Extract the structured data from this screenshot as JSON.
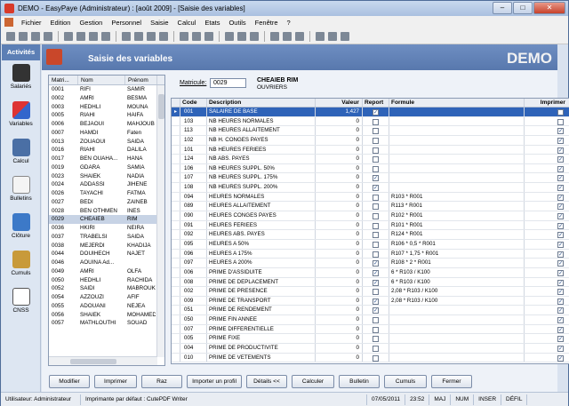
{
  "window": {
    "title": "DEMO - EasyPaye (Administrateur) : [août 2009] - [Saisie des variables]",
    "min": "–",
    "max": "□",
    "close": "✕"
  },
  "menu": [
    "Fichier",
    "Edition",
    "Gestion",
    "Personnel",
    "Saisie",
    "Calcul",
    "Etats",
    "Outils",
    "Fenêtre",
    "?"
  ],
  "sidebar": {
    "title": "Activités",
    "items": [
      "Salariés",
      "Variables",
      "Calcul",
      "Bulletins",
      "Clôture",
      "Cumuls",
      "CNSS"
    ]
  },
  "header": {
    "title": "Saisie des variables",
    "brand": "DEMO"
  },
  "employees": {
    "columns": [
      "Matri...",
      "Nom",
      "Prénom"
    ],
    "rows": [
      [
        "0001",
        "RIFI",
        "SAMIR"
      ],
      [
        "0002",
        "AMRI",
        "BESMA"
      ],
      [
        "0003",
        "HEDHLI",
        "MOUNA"
      ],
      [
        "0005",
        "RIAHI",
        "HAIFA"
      ],
      [
        "0006",
        "BEJAOUI",
        "MAHJOUB"
      ],
      [
        "0007",
        "HAMDI",
        "Faten"
      ],
      [
        "0013",
        "ZOUAOUI",
        "SAIDA"
      ],
      [
        "0016",
        "RIAHI",
        "DALILA"
      ],
      [
        "0017",
        "BEN OUAHA...",
        "HANA"
      ],
      [
        "0019",
        "GDARA",
        "SAMIA"
      ],
      [
        "0023",
        "SHAIEK",
        "NADIA"
      ],
      [
        "0024",
        "ADDASSI",
        "JIHENE"
      ],
      [
        "0026",
        "TAYACHI",
        "FATMA"
      ],
      [
        "0027",
        "BEDI",
        "ZAINEB"
      ],
      [
        "0028",
        "BEN OTHMEN",
        "INES"
      ],
      [
        "0029",
        "CHEAIEB",
        "RIM"
      ],
      [
        "0036",
        "HKIRI",
        "NEIRA"
      ],
      [
        "0037",
        "TRABELSI",
        "SAIDA"
      ],
      [
        "0038",
        "MEJERDI",
        "KHADIJA"
      ],
      [
        "0044",
        "DOUIHECH",
        "NAJET"
      ],
      [
        "0046",
        "AOUINA Ad...",
        ""
      ],
      [
        "0049",
        "AMRI",
        "OLFA"
      ],
      [
        "0050",
        "HEDHLI",
        "RACHIDA"
      ],
      [
        "0052",
        "SAIDI",
        "MABROUK"
      ],
      [
        "0054",
        "AZZOUZI",
        "AFIF"
      ],
      [
        "0055",
        "ADOUANI",
        "NEJEA"
      ],
      [
        "0056",
        "SHAIEK",
        "MOHAMED"
      ],
      [
        "0057",
        "MATHLOUTHI",
        "SOUAD"
      ]
    ],
    "selected_index": 15
  },
  "matricule": {
    "label": "Matricule:",
    "value": "0029"
  },
  "employee": {
    "name": "CHEAIEB RIM",
    "category": "OUVRIERS"
  },
  "grid": {
    "columns": [
      "",
      "Code",
      "Description",
      "Valeur",
      "Report",
      "Formule",
      "Imprimer"
    ],
    "rows": [
      {
        "code": "001",
        "desc": "SALAIRE DE BASE",
        "val": "1,427",
        "report": true,
        "formula": "",
        "print": false
      },
      {
        "code": "103",
        "desc": "NB HEURES NORMALES",
        "val": "0",
        "report": false,
        "formula": "",
        "print": false
      },
      {
        "code": "113",
        "desc": "NB HEURES ALLAITEMENT",
        "val": "0",
        "report": false,
        "formula": "",
        "print": true
      },
      {
        "code": "102",
        "desc": "NB H. CONGES PAYES",
        "val": "0",
        "report": false,
        "formula": "",
        "print": true
      },
      {
        "code": "101",
        "desc": "NB HEURES FERIEES",
        "val": "0",
        "report": false,
        "formula": "",
        "print": true
      },
      {
        "code": "124",
        "desc": "NB ABS. PAYES",
        "val": "0",
        "report": false,
        "formula": "",
        "print": true
      },
      {
        "code": "106",
        "desc": "NB HEURES SUPPL. 50%",
        "val": "0",
        "report": false,
        "formula": "",
        "print": true
      },
      {
        "code": "107",
        "desc": "NB HEURES SUPPL. 175%",
        "val": "0",
        "report": true,
        "formula": "",
        "print": true
      },
      {
        "code": "108",
        "desc": "NB HEURES SUPPL. 200%",
        "val": "0",
        "report": true,
        "formula": "",
        "print": true
      },
      {
        "code": "094",
        "desc": "HEURES NORMALES",
        "val": "0",
        "report": false,
        "formula": "R103 * R001",
        "print": true
      },
      {
        "code": "089",
        "desc": "HEURES ALLAITEMENT",
        "val": "0",
        "report": false,
        "formula": "R113 * R001",
        "print": true
      },
      {
        "code": "090",
        "desc": "HEURES CONGES PAYES",
        "val": "0",
        "report": false,
        "formula": "R102 * R001",
        "print": true
      },
      {
        "code": "091",
        "desc": "HEURES FERIEES",
        "val": "0",
        "report": false,
        "formula": "R101 * R001",
        "print": true
      },
      {
        "code": "092",
        "desc": "HEURES ABS. PAYES",
        "val": "0",
        "report": false,
        "formula": "R124 * R001",
        "print": true
      },
      {
        "code": "095",
        "desc": "HEURES A 50%",
        "val": "0",
        "report": false,
        "formula": "R106 * 0,5 * R001",
        "print": true
      },
      {
        "code": "096",
        "desc": "HEURES A 175%",
        "val": "0",
        "report": false,
        "formula": "R107 * 1,75 * R001",
        "print": true
      },
      {
        "code": "097",
        "desc": "HEURES A 200%",
        "val": "0",
        "report": true,
        "formula": "R108 * 2 * R001",
        "print": true
      },
      {
        "code": "006",
        "desc": "PRIME D'ASSIDUITE",
        "val": "0",
        "report": true,
        "formula": "6 * R103 / K100",
        "print": true
      },
      {
        "code": "008",
        "desc": "PRIME DE DEPLACEMENT",
        "val": "0",
        "report": true,
        "formula": "6 * R103 / K100",
        "print": true
      },
      {
        "code": "002",
        "desc": "PRIME DE PRESENCE",
        "val": "0",
        "report": false,
        "formula": "2,08 * R103 / K100",
        "print": true
      },
      {
        "code": "009",
        "desc": "PRIME DE TRANSPORT",
        "val": "0",
        "report": true,
        "formula": "2,08 * R103 / K100",
        "print": true
      },
      {
        "code": "051",
        "desc": "PRIME DE RENDEMENT",
        "val": "0",
        "report": true,
        "formula": "",
        "print": true
      },
      {
        "code": "050",
        "desc": "PRIME FIN ANNEE",
        "val": "0",
        "report": false,
        "formula": "",
        "print": true
      },
      {
        "code": "007",
        "desc": "PRIME DIFFERENTIELLE",
        "val": "0",
        "report": false,
        "formula": "",
        "print": true
      },
      {
        "code": "005",
        "desc": "PRIME FIXE",
        "val": "0",
        "report": false,
        "formula": "",
        "print": true
      },
      {
        "code": "004",
        "desc": "PRIME DE PRODUCTIVITE",
        "val": "0",
        "report": false,
        "formula": "",
        "print": true
      },
      {
        "code": "010",
        "desc": "PRIME DE VETEMENTS",
        "val": "0",
        "report": false,
        "formula": "",
        "print": true
      }
    ]
  },
  "buttons": [
    "Modifier",
    "Imprimer",
    "Raz",
    "Importer un profil",
    "Détails <<",
    "Calculer",
    "Bulletin",
    "Cumuls",
    "Fermer"
  ],
  "status": {
    "user": "Utilisateur: Administrateur",
    "printer": "Imprimante par défaut : CutePDF Writer",
    "date": "07/05/2011",
    "time": "23:52",
    "indicators": [
      "MAJ",
      "NUM",
      "INSER",
      "DÉFIL"
    ]
  }
}
